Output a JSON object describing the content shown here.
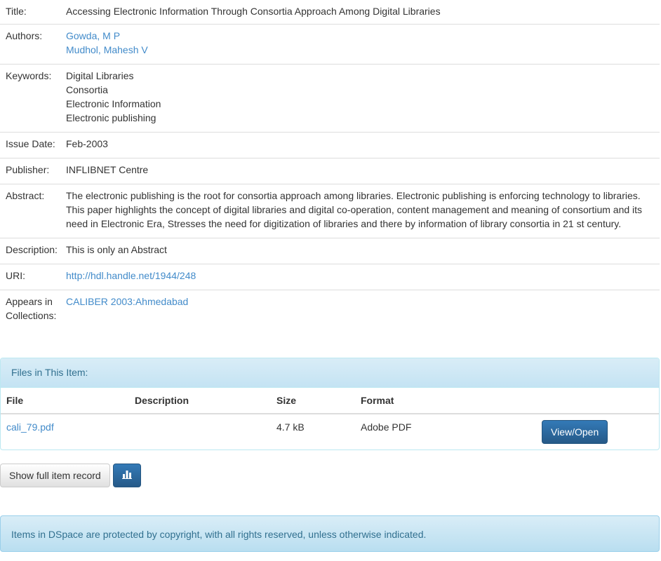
{
  "metadata": {
    "title": {
      "label": "Title:",
      "value": "Accessing Electronic Information Through Consortia Approach Among Digital Libraries"
    },
    "authors": {
      "label": "Authors:",
      "items": [
        "Gowda, M P",
        "Mudhol, Mahesh V"
      ]
    },
    "keywords": {
      "label": "Keywords:",
      "items": [
        "Digital Libraries",
        "Consortia",
        "Electronic Information",
        "Electronic publishing"
      ]
    },
    "issue_date": {
      "label": "Issue Date:",
      "value": "Feb-2003"
    },
    "publisher": {
      "label": "Publisher:",
      "value": "INFLIBNET Centre"
    },
    "abstract": {
      "label": "Abstract:",
      "value": "The electronic publishing is the root for consortia approach among libraries. Electronic publishing is enforcing technology to libraries. This paper highlights the concept of digital libraries and digital co-operation, content management and meaning of consortium and its need in Electronic Era, Stresses the need for digitization of libraries and there by information of library consortia in 21 st century."
    },
    "description": {
      "label": "Description:",
      "value": "This is only an Abstract"
    },
    "uri": {
      "label": "URI:",
      "value": "http://hdl.handle.net/1944/248"
    },
    "collections": {
      "label_line1": "Appears in",
      "label_line2": "Collections:",
      "value": "CALIBER 2003:Ahmedabad"
    }
  },
  "files_panel": {
    "heading": "Files in This Item:",
    "columns": [
      "File",
      "Description",
      "Size",
      "Format"
    ],
    "rows": [
      {
        "file": "cali_79.pdf",
        "description": "",
        "size": "4.7 kB",
        "format": "Adobe PDF",
        "action": "View/Open"
      }
    ]
  },
  "actions": {
    "show_full_record": "Show full item record",
    "stats_icon": "bar-chart-icon"
  },
  "footer_notice": "Items in DSpace are protected by copyright, with all rights reserved, unless otherwise indicated.",
  "colors": {
    "link": "#428bca",
    "primary": "#337ab7",
    "info_text": "#31708f",
    "info_bg": "#d9edf7"
  }
}
